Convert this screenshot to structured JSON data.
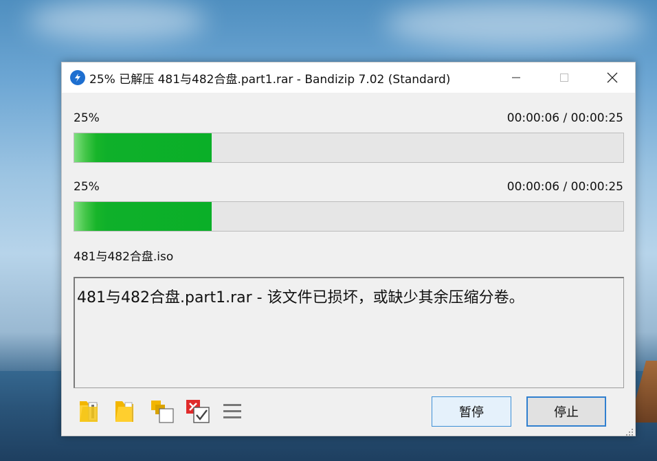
{
  "window": {
    "title": "25% 已解压 481与482合盘.part1.rar - Bandizip 7.02 (Standard)",
    "app_icon": "bandizip-icon",
    "controls": [
      "minimize-icon",
      "maximize-icon",
      "close-icon"
    ]
  },
  "progress": [
    {
      "percent_label": "25%",
      "time": "00:00:06 / 00:00:25",
      "value": 0.25
    },
    {
      "percent_label": "25%",
      "time": "00:00:06 / 00:00:25",
      "value": 0.25
    }
  ],
  "current_file": "481与482合盘.iso",
  "message": "481与482合盘.part1.rar - 该文件已损坏，或缺少其余压缩分卷。",
  "toolbar": {
    "icons": [
      "open-folder-icon",
      "folder-icon",
      "copy-icon",
      "checklist-icon",
      "menu-icon"
    ]
  },
  "buttons": {
    "pause": "暂停",
    "stop": "停止"
  },
  "colors": {
    "progress_fill": "#0aaf28",
    "accent": "#2f7fcf"
  }
}
